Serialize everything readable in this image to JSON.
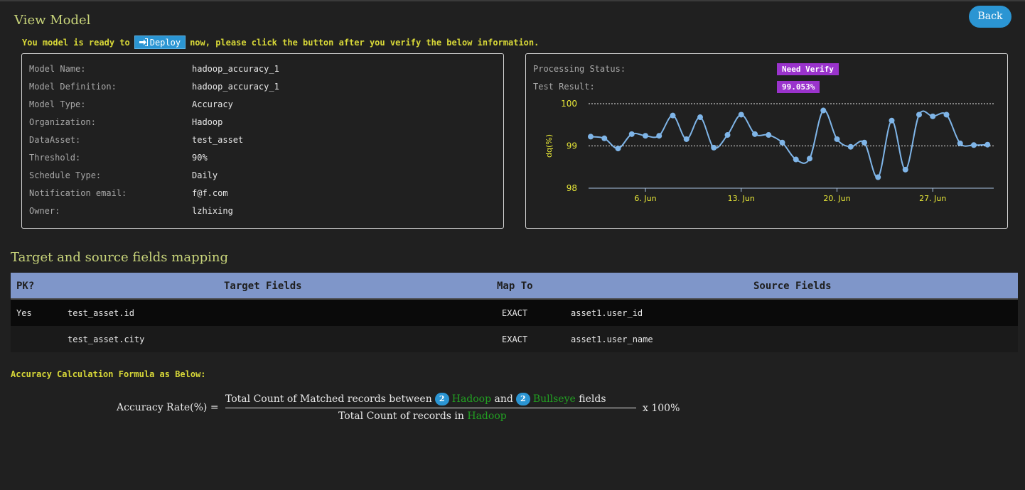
{
  "header": {
    "title": "View Model",
    "back_label": "Back"
  },
  "ready": {
    "prefix": "You model is ready to",
    "deploy_label": "Deploy",
    "suffix": "now, please click the button after you verify the below information."
  },
  "model_info": [
    {
      "label": "Model Name:",
      "value": "hadoop_accuracy_1"
    },
    {
      "label": "Model Definition:",
      "value": "hadoop_accuracy_1"
    },
    {
      "label": "Model Type:",
      "value": "Accuracy"
    },
    {
      "label": "Organization:",
      "value": "Hadoop"
    },
    {
      "label": "DataAsset:",
      "value": "test_asset"
    },
    {
      "label": "Threshold:",
      "value": "90%"
    },
    {
      "label": "Schedule Type:",
      "value": "Daily"
    },
    {
      "label": "Notification email:",
      "value": "f@f.com"
    },
    {
      "label": "Owner:",
      "value": "lzhixing"
    }
  ],
  "status": {
    "processing_label": "Processing Status:",
    "processing_value": "Need Verify",
    "test_label": "Test Result:",
    "test_value": "99.053%",
    "badge_color": "#9a33cc"
  },
  "chart_data": {
    "type": "line",
    "ylabel": "dq(%)",
    "ylim": [
      98,
      100
    ],
    "yticks": [
      "98",
      "99",
      "100"
    ],
    "xticks": [
      "6. Jun",
      "13. Jun",
      "20. Jun",
      "27. Jun"
    ],
    "series": [
      {
        "values": [
          99.22,
          99.18,
          98.94,
          99.28,
          99.24,
          99.24,
          99.72,
          99.16,
          99.68,
          98.96,
          99.26,
          99.74,
          99.28,
          99.26,
          99.08,
          98.68,
          98.7,
          99.84,
          99.16,
          98.98,
          99.08,
          98.26,
          99.6,
          98.44,
          99.74,
          99.7,
          99.74,
          99.06,
          99.02,
          99.03
        ]
      }
    ],
    "line_color": "#7fb5e8"
  },
  "mapping": {
    "title": "Target and source fields mapping",
    "headers": [
      "PK?",
      "Target Fields",
      "Map To",
      "Source Fields"
    ],
    "rows": [
      {
        "pk": "Yes",
        "target": "test_asset.id",
        "map": "EXACT",
        "source": "asset1.user_id"
      },
      {
        "pk": "",
        "target": "test_asset.city",
        "map": "EXACT",
        "source": "asset1.user_name"
      }
    ]
  },
  "formula": {
    "title": "Accuracy Calculation Formula as Below:",
    "lhs": "Accuracy Rate(%) =",
    "num_a": "Total Count of Matched records between",
    "count1": "2",
    "asset1": "Hadoop",
    "and": "and",
    "count2": "2",
    "asset2": "Bullseye",
    "fields": "fields",
    "den_a": "Total Count of records in",
    "den_asset": "Hadoop",
    "multiplier": "x 100%"
  }
}
